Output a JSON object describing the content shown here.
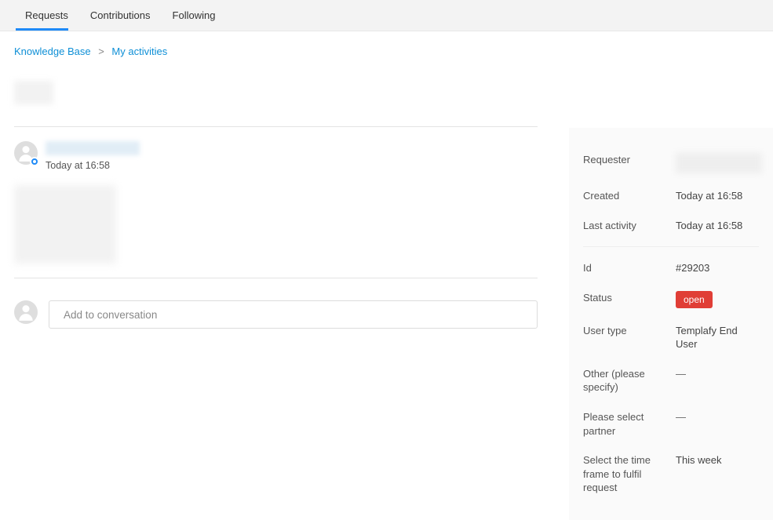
{
  "tabs": {
    "requests": "Requests",
    "contributions": "Contributions",
    "following": "Following"
  },
  "breadcrumb": {
    "root": "Knowledge Base",
    "sep": ">",
    "current": "My activities"
  },
  "comment": {
    "timestamp": "Today at 16:58"
  },
  "reply": {
    "placeholder": "Add to conversation"
  },
  "details": {
    "requester_label": "Requester",
    "created_label": "Created",
    "created": "Today at 16:58",
    "last_activity_label": "Last activity",
    "last_activity": "Today at 16:58",
    "id_label": "Id",
    "id": "#29203",
    "status_label": "Status",
    "status": "open",
    "user_type_label": "User type",
    "user_type": "Templafy End User",
    "other_label": "Other (please specify)",
    "other": "—",
    "partner_label": "Please select partner",
    "partner": "—",
    "timeframe_label": "Select the time frame to fulfil request",
    "timeframe": "This week"
  }
}
